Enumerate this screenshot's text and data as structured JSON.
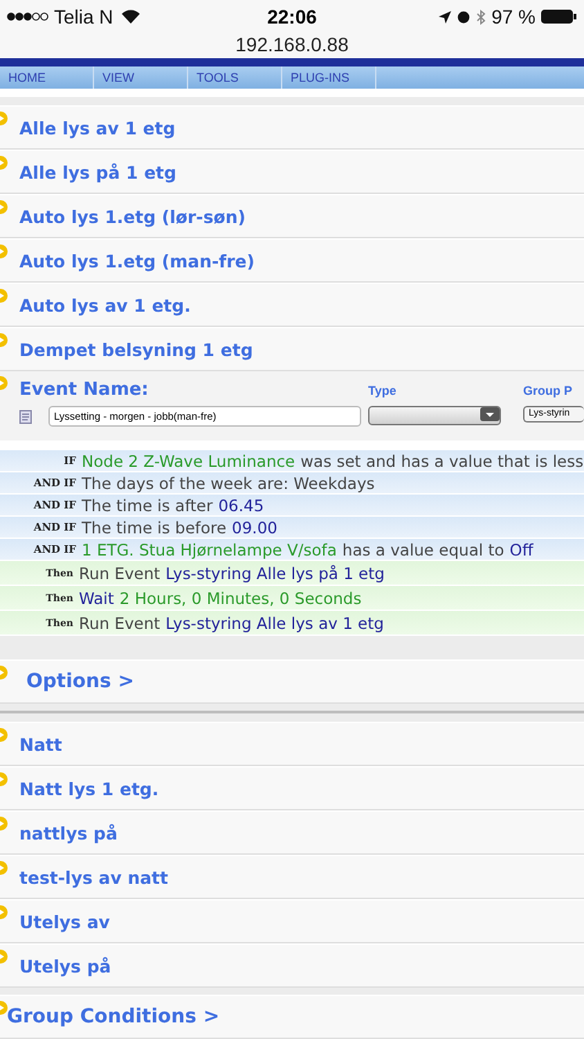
{
  "status_bar": {
    "carrier": "Telia N",
    "time": "22:06",
    "battery": "97 %"
  },
  "url": "192.168.0.88",
  "menu": [
    {
      "label": "HOME"
    },
    {
      "label": "VIEW"
    },
    {
      "label": "TOOLS"
    },
    {
      "label": "PLUG-INS"
    }
  ],
  "events_top": [
    {
      "name": "Alle lys av 1 etg"
    },
    {
      "name": "Alle lys på 1 etg"
    },
    {
      "name": "Auto lys 1.etg (lør-søn)"
    },
    {
      "name": "Auto lys 1.etg (man-fre)"
    },
    {
      "name": "Auto lys av 1 etg."
    },
    {
      "name": "Dempet belsyning 1 etg"
    }
  ],
  "editor": {
    "name_label": "Event Name:",
    "name_value": "Lyssetting - morgen - jobb(man-fre)",
    "type_label": "Type",
    "group_label": "Group P",
    "group_value": "Lys-styrin"
  },
  "conditions": [
    {
      "keyword": "IF",
      "kind": "if",
      "parts": [
        {
          "kind": "device",
          "text": "Node 2 Z-Wave Luminance"
        },
        {
          "kind": "plain",
          "text": "was set and has a value that is less"
        }
      ]
    },
    {
      "keyword": "AND IF",
      "kind": "if",
      "parts": [
        {
          "kind": "plain",
          "text": "The days of the week are: Weekdays"
        }
      ]
    },
    {
      "keyword": "AND IF",
      "kind": "if",
      "parts": [
        {
          "kind": "plain",
          "text": "The time is after"
        },
        {
          "kind": "value",
          "text": "06.45"
        }
      ]
    },
    {
      "keyword": "AND IF",
      "kind": "if",
      "parts": [
        {
          "kind": "plain",
          "text": "The time is before"
        },
        {
          "kind": "value",
          "text": "09.00"
        }
      ]
    },
    {
      "keyword": "AND IF",
      "kind": "if",
      "parts": [
        {
          "kind": "device",
          "text": "1 ETG. Stua Hjørnelampe V/sofa"
        },
        {
          "kind": "plain",
          "text": "has a value equal to"
        },
        {
          "kind": "value",
          "text": "Off"
        }
      ]
    },
    {
      "keyword": "Then",
      "kind": "then",
      "parts": [
        {
          "kind": "plain",
          "text": "Run Event"
        },
        {
          "kind": "value",
          "text": "Lys-styring Alle lys på 1 etg"
        }
      ]
    },
    {
      "keyword": "Then",
      "kind": "then",
      "parts": [
        {
          "kind": "value",
          "text": "Wait"
        },
        {
          "kind": "device",
          "text": "2 Hours, 0 Minutes, 0 Seconds"
        }
      ]
    },
    {
      "keyword": "Then",
      "kind": "then",
      "parts": [
        {
          "kind": "plain",
          "text": "Run Event"
        },
        {
          "kind": "value",
          "text": "Lys-styring Alle lys av 1 etg"
        }
      ]
    }
  ],
  "options": "Options >",
  "events_bottom": [
    {
      "name": "Natt"
    },
    {
      "name": "Natt lys 1 etg."
    },
    {
      "name": "nattlys på"
    },
    {
      "name": "test-lys av natt"
    },
    {
      "name": "Utelys av"
    },
    {
      "name": "Utelys på"
    }
  ],
  "group_conditions": "Group Conditions >"
}
